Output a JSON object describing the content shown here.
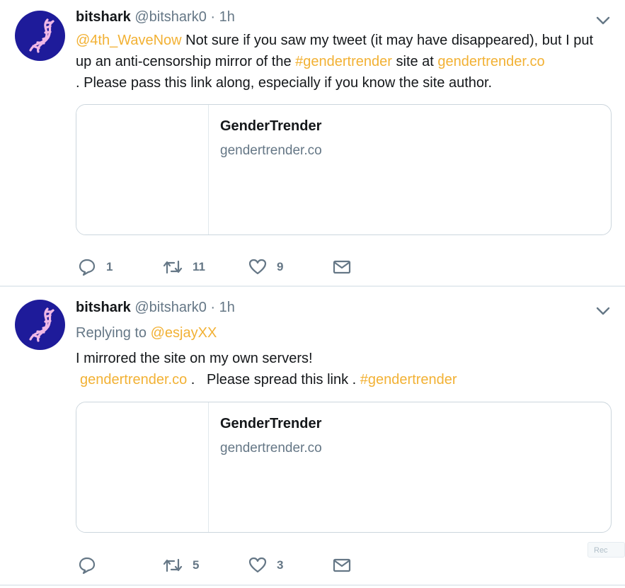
{
  "tweets": [
    {
      "author": {
        "name": "bitshark",
        "handle": "@bitshark0",
        "avatar_icon": "dna-helix-icon"
      },
      "separator": "·",
      "time": "1h",
      "text": {
        "mention": "@4th_WaveNow",
        "part1": " Not sure if you saw my tweet (it may have disappeared), but I put up an anti-censorship mirror of the ",
        "hashtag": "#gendertrender",
        "part2": " site at ",
        "link": "gendertrender.co",
        "part3": " .  Please pass this link along, especially if you know the site author."
      },
      "card": {
        "title": "GenderTrender",
        "domain": "gendertrender.co"
      },
      "actions": {
        "reply": "1",
        "retweet": "11",
        "like": "9"
      }
    },
    {
      "author": {
        "name": "bitshark",
        "handle": "@bitshark0",
        "avatar_icon": "dna-helix-icon"
      },
      "separator": "·",
      "time": "1h",
      "replying_prefix": "Replying to ",
      "replying_to": "@esjayXX",
      "text": {
        "line1": "I mirrored the site on my own servers!",
        "link": "gendertrender.co",
        "middle": " .   Please spread this link . ",
        "hashtag": "#gendertrender"
      },
      "card": {
        "title": "GenderTrender",
        "domain": "gendertrender.co"
      },
      "actions": {
        "reply": "",
        "retweet": "5",
        "like": "3"
      }
    }
  ],
  "ghost_text": "Rec",
  "colors": {
    "link": "#f2b134",
    "muted": "#657786",
    "avatar_bg": "#1e1b9a",
    "dna": "#f0b8e6",
    "border": "#ccd6dd"
  },
  "icons": [
    "reply-icon",
    "retweet-icon",
    "like-icon",
    "message-icon",
    "chevron-down-icon"
  ]
}
